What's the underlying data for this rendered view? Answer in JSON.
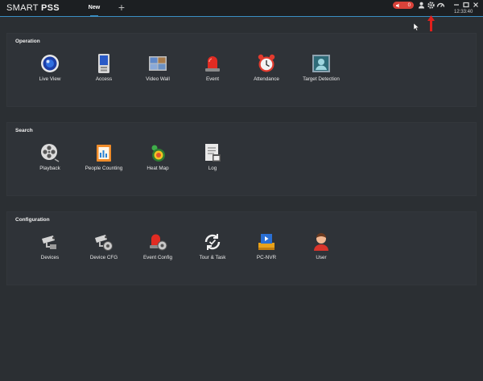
{
  "app": {
    "logo_light": "SMART ",
    "logo_bold": "PSS"
  },
  "tabs": {
    "active_label": "New",
    "add_label": "+"
  },
  "status": {
    "alarm_count": "0",
    "time": "12:33:40"
  },
  "sections": {
    "operation": {
      "title": "Operation",
      "items": [
        {
          "label": "Live View",
          "icon": "live-view-icon"
        },
        {
          "label": "Access",
          "icon": "access-icon"
        },
        {
          "label": "Video Wall",
          "icon": "video-wall-icon"
        },
        {
          "label": "Event",
          "icon": "event-icon"
        },
        {
          "label": "Attendance",
          "icon": "attendance-icon"
        },
        {
          "label": "Target Detection",
          "icon": "target-detection-icon"
        }
      ]
    },
    "search": {
      "title": "Search",
      "items": [
        {
          "label": "Playback",
          "icon": "playback-icon"
        },
        {
          "label": "People Counting",
          "icon": "people-counting-icon"
        },
        {
          "label": "Heat Map",
          "icon": "heat-map-icon"
        },
        {
          "label": "Log",
          "icon": "log-icon"
        }
      ]
    },
    "configuration": {
      "title": "Configuration",
      "items": [
        {
          "label": "Devices",
          "icon": "devices-icon"
        },
        {
          "label": "Device CFG",
          "icon": "device-cfg-icon"
        },
        {
          "label": "Event Config",
          "icon": "event-config-icon"
        },
        {
          "label": "Tour & Task",
          "icon": "tour-task-icon"
        },
        {
          "label": "PC-NVR",
          "icon": "pc-nvr-icon"
        },
        {
          "label": "User",
          "icon": "user-icon"
        }
      ]
    }
  },
  "colors": {
    "background": "#2b2f33",
    "panel": "#2f3338",
    "titlebar": "#1c1f22",
    "accent": "#3a8fc4",
    "alarm": "#d9423a",
    "annotation_arrow": "#e0201c"
  }
}
